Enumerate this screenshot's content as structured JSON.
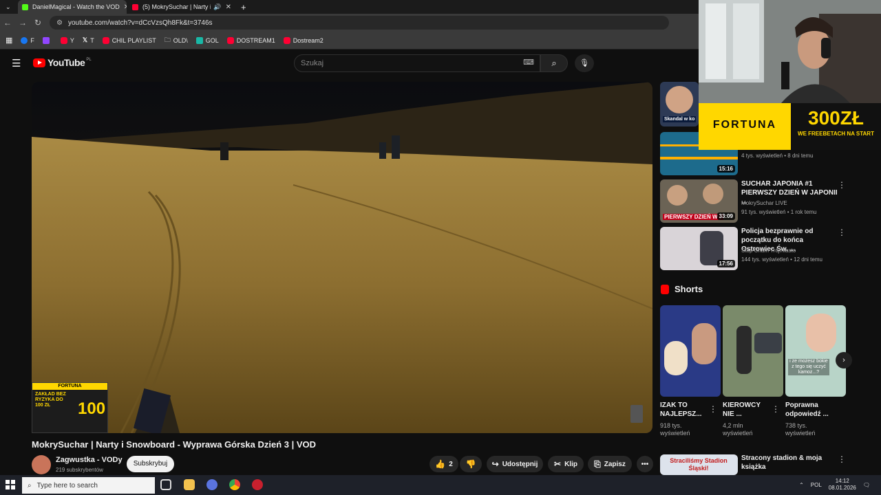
{
  "browser": {
    "tabs": [
      {
        "title": "DanielMagical - Watch the VOD",
        "active": true,
        "favicon_color": "#53fc18"
      },
      {
        "title": "(5) MokrySuchar | Narty i Sno",
        "active": false,
        "favicon_color": "#ff0033"
      }
    ],
    "new_tab_label": "+",
    "url": "youtube.com/watch?v=dCcVzsQh8Fk&t=3746s",
    "bookmarks": [
      {
        "label": "F",
        "color": "#1877f2"
      },
      {
        "label": "",
        "color": "#9146ff"
      },
      {
        "label": "Y",
        "color": "#ff0033"
      },
      {
        "label": "T",
        "color": "#ffffff"
      },
      {
        "label": "CHIL PLAYLIST",
        "color": "#ff0033"
      },
      {
        "label": "OLD\\",
        "color": "#cccccc"
      },
      {
        "label": "GOL",
        "color": "#19b8a6"
      },
      {
        "label": "DOSTREAM1",
        "color": "#ff0033"
      },
      {
        "label": "Dostream2",
        "color": "#ff0033"
      }
    ]
  },
  "youtube": {
    "logo": "YouTube",
    "country": "PL",
    "search_placeholder": "Szukaj"
  },
  "video": {
    "title": "MokrySuchar | Narty i Snowboard - Wyprawa Górska Dzień 3 | VOD",
    "channel": "Zagwustka - VODy",
    "subscribers": "219 subskrybentów",
    "subscribe_label": "Subskrybuj",
    "likes": "2",
    "share_label": "Udostępnij",
    "clip_label": "Klip",
    "save_label": "Zapisz",
    "promo": {
      "brand": "FORTUNA",
      "text": "ZAKŁAD BEZ RYZYKA DO 100 ZŁ",
      "amount": "100"
    }
  },
  "overlay": {
    "fortuna_brand": "FORTUNA",
    "fortuna_amount": "300ZŁ",
    "fortuna_sub": "WE FREEBETACH NA START"
  },
  "sidebar": {
    "recommended": [
      {
        "title": "",
        "channel": "",
        "meta": "",
        "duration": "",
        "thumb_label": "Skandal w ko"
      },
      {
        "title": "",
        "channel": "",
        "meta": "4 tys. wyświetleń • 8 dni temu",
        "duration": "15:16",
        "thumb_label": ""
      },
      {
        "title": "SUCHAR JAPONIA #1 PIERWSZY DZIEŃ W JAPONII ...",
        "channel": "MokrySuchar LIVE",
        "meta": "91 tys. wyświetleń • 1 rok temu",
        "duration": "33:09",
        "thumb_label": "PIERWSZY DZIEŃ W J"
      },
      {
        "title": "Policja bezprawnie od początku do końca Ostrowiec Św. ...",
        "channel": "Stop Cham Trójmiasto",
        "meta": "144 tys. wyświetleń • 12 dni temu",
        "duration": "17:56",
        "thumb_label": ""
      }
    ],
    "shorts_heading": "Shorts",
    "shorts": [
      {
        "title": "IZAK TO NAJLEPSZ...",
        "views": "918 tys. wyświetleń"
      },
      {
        "title": "KIEROWCY NIE ...",
        "views": "4,2 mln wyświetleń"
      },
      {
        "title": "Poprawna odpowiedź ...",
        "views": "738 tys. wyświetleń",
        "thumb_label": "i ze możesz bokie z tego się uczyć kamoz...?"
      }
    ],
    "bottom": {
      "thumb_label": "Straciliśmy Stadion Śląski!",
      "title": "Stracony stadion & moja książka"
    }
  },
  "taskbar": {
    "search_placeholder": "Type here to search",
    "language": "POL",
    "time": "14:12",
    "date": "08.01.2026"
  }
}
